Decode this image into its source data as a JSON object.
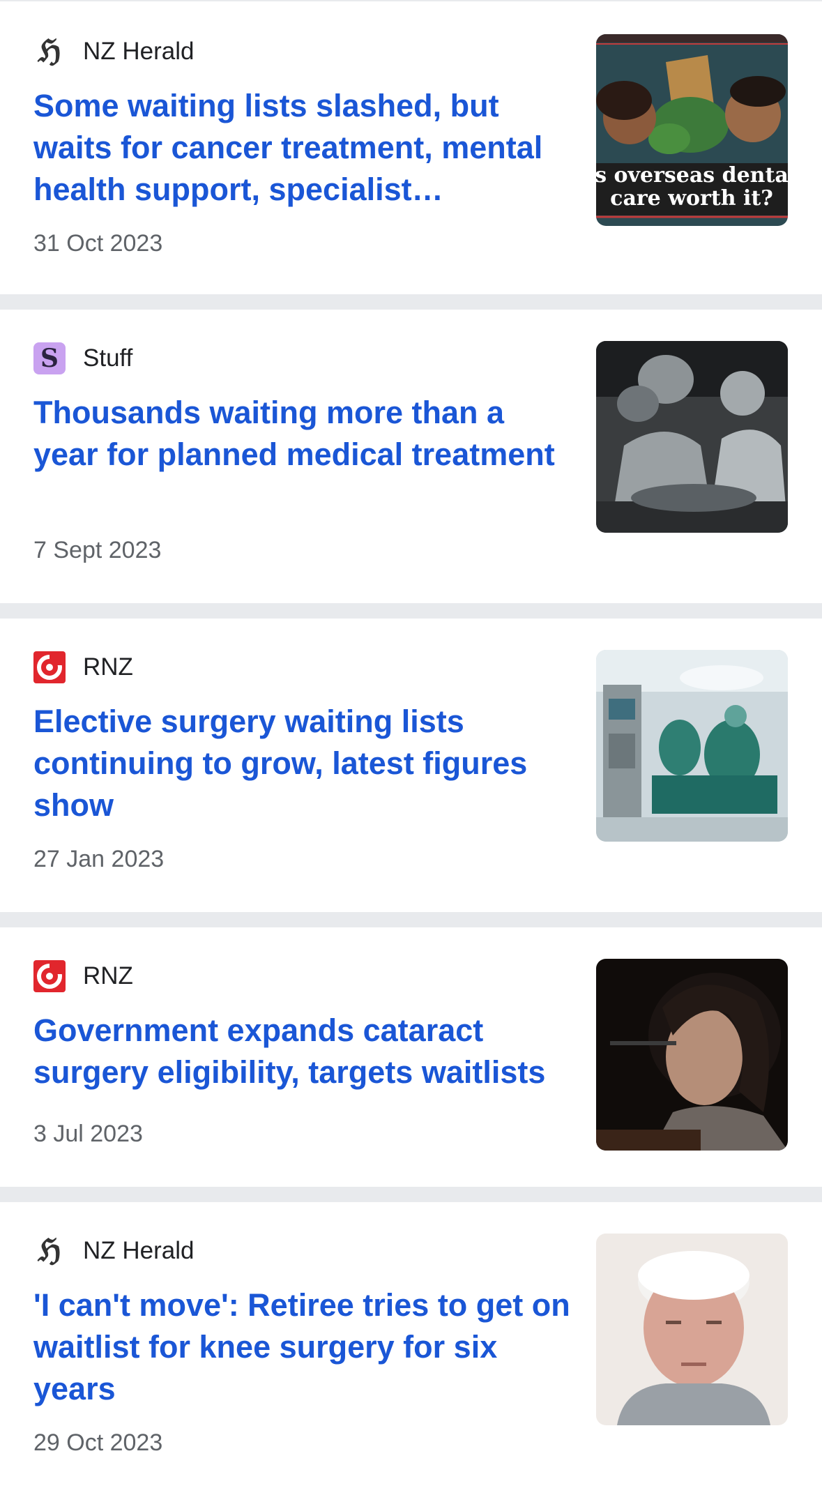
{
  "articles": [
    {
      "source": "NZ Herald",
      "source_icon": "nz-herald-logo-icon",
      "headline": "Some waiting lists slashed, but waits for cancer treatment, mental health support, specialist…",
      "date": "31 Oct 2023",
      "thumbnail_caption": [
        "s overseas denta",
        "care worth it?"
      ]
    },
    {
      "source": "Stuff",
      "source_icon": "stuff-logo-icon",
      "source_icon_glyph": "S",
      "headline": "Thousands waiting more than a year for planned medical treatment",
      "date": "7 Sept 2023"
    },
    {
      "source": "RNZ",
      "source_icon": "rnz-logo-icon",
      "headline": "Elective surgery waiting lists continuing to grow, latest figures show",
      "date": "27 Jan 2023"
    },
    {
      "source": "RNZ",
      "source_icon": "rnz-logo-icon",
      "headline": "Government expands cataract surgery eligibility, targets waitlists",
      "date": "3 Jul 2023"
    },
    {
      "source": "NZ Herald",
      "source_icon": "nz-herald-logo-icon",
      "headline": "'I can't move': Retiree tries to get on waitlist for knee surgery for six years",
      "date": "29 Oct 2023"
    }
  ],
  "colors": {
    "headline": "#1a56d6",
    "date": "#5f6368",
    "source": "#202124",
    "separator": "#e8eaed",
    "rnz_red": "#e1262d",
    "stuff_purple": "#c9a2f0"
  }
}
